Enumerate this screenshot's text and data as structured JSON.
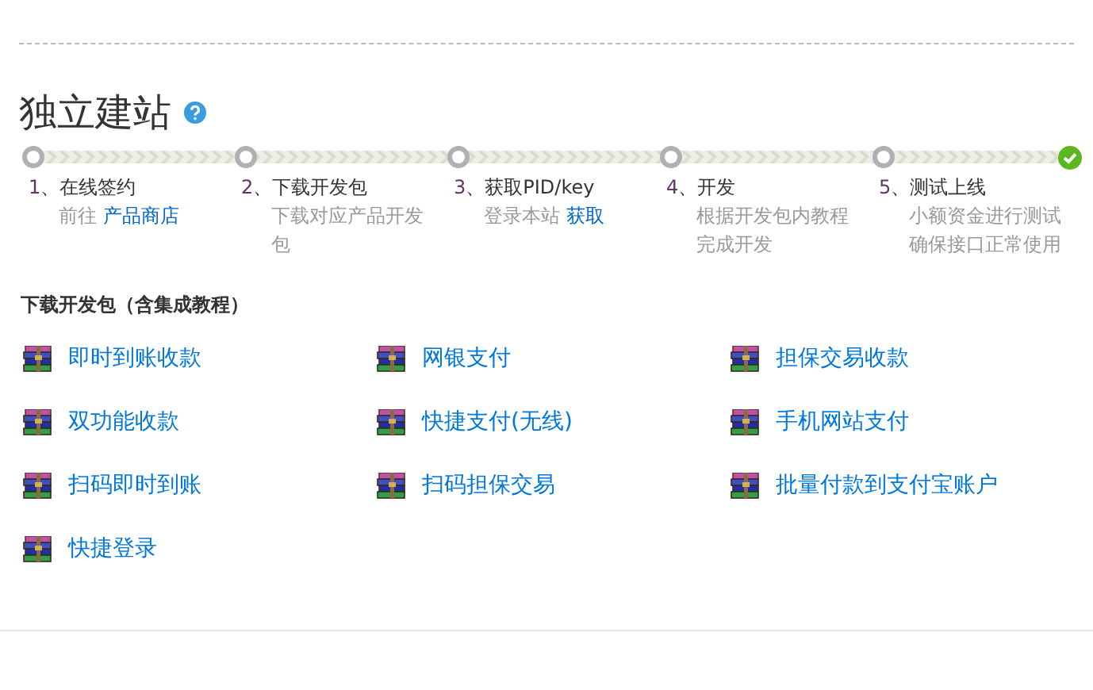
{
  "title": "独立建站",
  "steps": [
    {
      "number": "1",
      "title": "、在线签约",
      "desc": "前往 ",
      "link": "产品商店"
    },
    {
      "number": "2",
      "title": "、下载开发包",
      "desc": "下载对应产品开发包"
    },
    {
      "number": "3",
      "title": "、获取PID/key",
      "desc": "登录本站 ",
      "link": "获取"
    },
    {
      "number": "4",
      "title": "、开发",
      "desc": "根据开发包内教程完成开发"
    },
    {
      "number": "5",
      "title": "、测试上线",
      "desc": "小额资金进行测试确保接口正常使用"
    }
  ],
  "section_title": "下载开发包（含集成教程）",
  "downloads": [
    "即时到账收款",
    "网银支付",
    "担保交易收款",
    "双功能收款",
    "快捷支付(无线)",
    "手机网站支付",
    "扫码即时到账",
    "扫码担保交易",
    "批量付款到支付宝账户",
    "快捷登录"
  ]
}
